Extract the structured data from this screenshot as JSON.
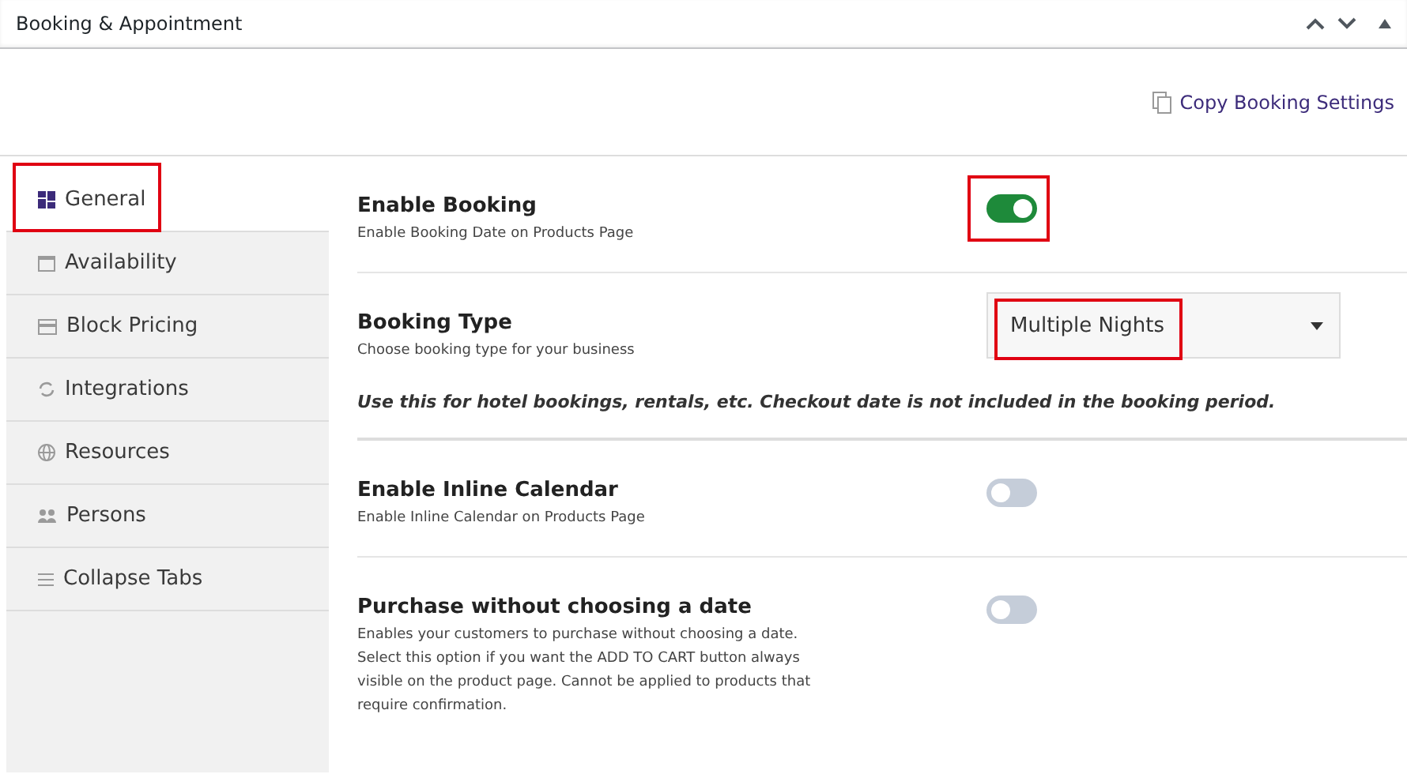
{
  "panel": {
    "title": "Booking & Appointment"
  },
  "copy_link": {
    "label": "Copy Booking Settings"
  },
  "tabs": [
    {
      "label": "General",
      "selected": true,
      "highlighted": true
    },
    {
      "label": "Availability",
      "selected": false,
      "highlighted": false
    },
    {
      "label": "Block Pricing",
      "selected": false,
      "highlighted": false
    },
    {
      "label": "Integrations",
      "selected": false,
      "highlighted": false
    },
    {
      "label": "Resources",
      "selected": false,
      "highlighted": false
    },
    {
      "label": "Persons",
      "selected": false,
      "highlighted": false
    },
    {
      "label": "Collapse Tabs",
      "selected": false,
      "highlighted": false
    }
  ],
  "settings": [
    {
      "kind": "toggle",
      "title": "Enable Booking",
      "description": "Enable Booking Date on Products Page",
      "on": true,
      "highlighted": true
    },
    {
      "kind": "select",
      "title": "Booking Type",
      "description": "Choose booking type for your business",
      "value": "Multiple Nights",
      "highlighted": true,
      "note": "Use this for hotel bookings, rentals, etc. Checkout date is not included in the booking period."
    },
    {
      "kind": "toggle",
      "title": "Enable Inline Calendar",
      "description": "Enable Inline Calendar on Products Page",
      "on": false,
      "highlighted": false
    },
    {
      "kind": "toggle",
      "title": "Purchase without choosing a date",
      "description": "Enables your customers to purchase without choosing a date. Select this option if you want the ADD TO CART button always visible on the product page. Cannot be applied to products that require confirmation.",
      "on": false,
      "highlighted": false
    }
  ]
}
